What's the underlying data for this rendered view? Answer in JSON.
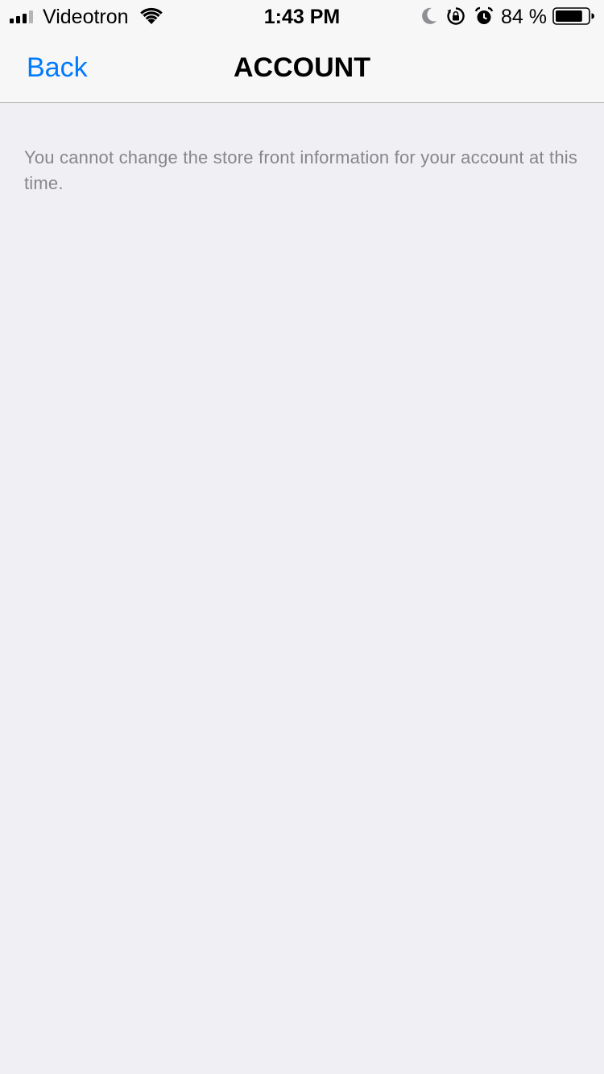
{
  "status_bar": {
    "carrier": "Videotron",
    "time": "1:43 PM",
    "battery_percent": "84 %",
    "battery_level": 0.84,
    "icons": [
      "signal-icon",
      "wifi-icon",
      "moon-icon",
      "rotation-lock-icon",
      "alarm-icon",
      "battery-icon"
    ]
  },
  "nav": {
    "back_label": "Back",
    "title": "ACCOUNT"
  },
  "content": {
    "message": "You cannot change the store front information for your account at this time."
  },
  "colors": {
    "background": "#efeff4",
    "nav_background": "#f7f7f7",
    "accent": "#007aff",
    "secondary_text": "#86868b"
  }
}
